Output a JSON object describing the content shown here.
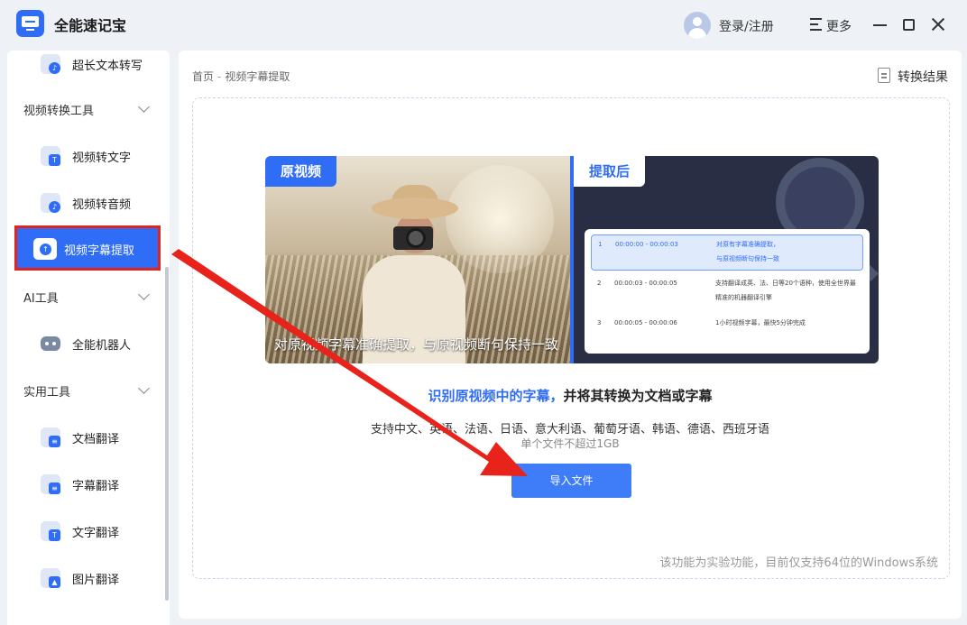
{
  "app": {
    "title": "全能速记宝"
  },
  "header": {
    "login": "登录/注册",
    "more": "更多"
  },
  "sidebar": {
    "items": [
      {
        "label": "超长文本转写",
        "glyph": "♪"
      },
      {
        "category": "视频转换工具"
      },
      {
        "label": "视频转文字",
        "glyph": "T"
      },
      {
        "label": "视频转音频",
        "glyph": "♪"
      },
      {
        "label": "视频字幕提取",
        "glyph": "↑",
        "active": true
      },
      {
        "category": "AI工具"
      },
      {
        "label": "全能机器人"
      },
      {
        "category": "实用工具"
      },
      {
        "label": "文档翻译",
        "glyph": "≡"
      },
      {
        "label": "字幕翻译",
        "glyph": "≡"
      },
      {
        "label": "文字翻译",
        "glyph": "T"
      },
      {
        "label": "图片翻译",
        "glyph": "▲"
      }
    ]
  },
  "breadcrumb": {
    "home": "首页",
    "sep": "-",
    "current": "视频字幕提取"
  },
  "toolbar": {
    "result": "转换结果"
  },
  "preview": {
    "original_tag": "原视频",
    "extracted_tag": "提取后",
    "overlay_subtitle": "对原视频字幕准确提取，与原视频断句保持一致",
    "subtitles": [
      {
        "no": "1",
        "time": "00:00:00  -  00:00:03",
        "text": "对原有字幕准确提取，\n与原视频断句保持一致",
        "highlight": true
      },
      {
        "no": "2",
        "time": "00:00:03  -  00:00:05",
        "text": "支持翻译成英、法、日等20个语种，使用全世界最精准的机器翻译引擎"
      },
      {
        "no": "3",
        "time": "00:00:05  -  00:00:06",
        "text": "1小时视频字幕，最快5分钟完成"
      }
    ]
  },
  "main": {
    "headline_accent": "识别原视频中的字幕，",
    "headline_rest": "并将其转换为文档或字幕",
    "languages": "支持中文、英语、法语、日语、意大利语、葡萄牙语、韩语、德语、西班牙语",
    "size_limit": "单个文件不超过1GB",
    "import_button": "导入文件",
    "footnote": "该功能为实验功能，目前仅支持64位的Windows系统"
  },
  "colors": {
    "accent": "#2f6df6",
    "highlight_border": "#e0241b",
    "annotation_arrow": "#e8231b"
  }
}
